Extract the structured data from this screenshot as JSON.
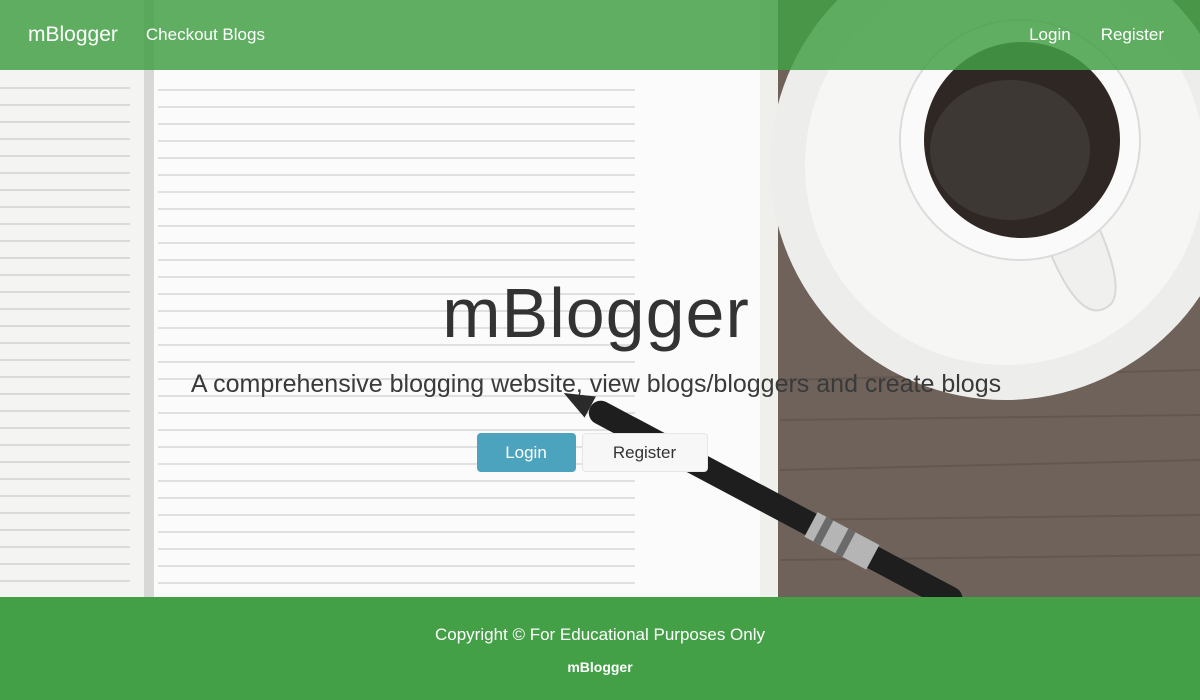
{
  "navbar": {
    "brand": "mBlogger",
    "checkout_link": "Checkout Blogs",
    "login_link": "Login",
    "register_link": "Register"
  },
  "hero": {
    "title": "mBlogger",
    "subtitle": "A comprehensive blogging website, view blogs/bloggers and create blogs",
    "login_button": "Login",
    "register_button": "Register"
  },
  "footer": {
    "copyright": "Copyright © For Educational Purposes Only",
    "brand": "mBlogger"
  },
  "colors": {
    "navbar": "#43a047",
    "footer": "#44a047",
    "login_button": "#4ba3bd"
  }
}
